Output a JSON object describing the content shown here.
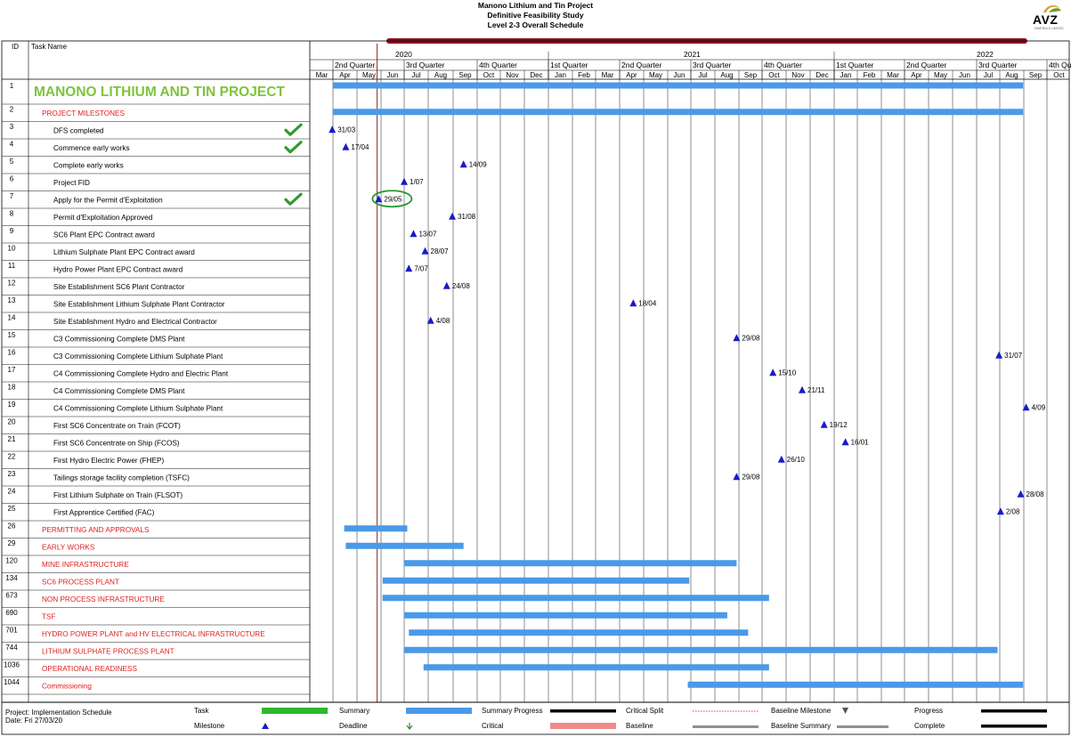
{
  "header": {
    "title_line1": "Manono Lithium and Tin Project",
    "title_line2": "Definitive Feasibility Study",
    "title_line3": "Level 2-3 Overall Schedule",
    "logo_text": "AVZ",
    "logo_subtext": "MINERALS LIMITED"
  },
  "columns": {
    "id": "ID",
    "task_name": "Task Name"
  },
  "timescale": {
    "years": [
      "2020",
      "2021",
      "2022"
    ],
    "quarters": [
      "2nd Quarter",
      "3rd Quarter",
      "4th Quarter",
      "1st Quarter",
      "2nd Quarter",
      "3rd Quarter",
      "4th Quarter",
      "1st Quarter",
      "2nd Quarter",
      "3rd Quarter",
      "4th Qu"
    ],
    "months": [
      "Mar",
      "Apr",
      "May",
      "Jun",
      "Jul",
      "Aug",
      "Sep",
      "Oct",
      "Nov",
      "Dec",
      "Jan",
      "Feb",
      "Mar",
      "Apr",
      "May",
      "Jun",
      "Jul",
      "Aug",
      "Sep",
      "Oct",
      "Nov",
      "Dec",
      "Jan",
      "Feb",
      "Mar",
      "Apr",
      "May",
      "Jun",
      "Jul",
      "Aug",
      "Sep",
      "Oct"
    ]
  },
  "chart_data": {
    "type": "gantt",
    "title": "Level 2-3 Overall Schedule",
    "status_date": "2020-05-27",
    "rows": [
      {
        "id": "1",
        "name": "MANONO LITHIUM AND TIN PROJECT",
        "kind": "project",
        "start": "2020-04-01",
        "end": "2022-08-31"
      },
      {
        "id": "2",
        "name": "PROJECT MILESTONES",
        "kind": "summary",
        "start": "2020-04-01",
        "end": "2022-08-31"
      },
      {
        "id": "3",
        "name": "DFS completed",
        "kind": "milestone",
        "date": "2020-03-31",
        "label": "31/03",
        "complete": true
      },
      {
        "id": "4",
        "name": "Commence early works",
        "kind": "milestone",
        "date": "2020-04-17",
        "label": "17/04",
        "complete": true
      },
      {
        "id": "5",
        "name": "Complete early works",
        "kind": "milestone",
        "date": "2020-09-14",
        "label": "14/09"
      },
      {
        "id": "6",
        "name": "Project FID",
        "kind": "milestone",
        "date": "2020-07-01",
        "label": "1/07"
      },
      {
        "id": "7",
        "name": "Apply for the Permit d'Exploitation",
        "kind": "milestone",
        "date": "2020-05-29",
        "label": "29/05",
        "complete": true,
        "highlighted": true
      },
      {
        "id": "8",
        "name": "Permit d'Exploitation Approved",
        "kind": "milestone",
        "date": "2020-08-31",
        "label": "31/08"
      },
      {
        "id": "9",
        "name": "SC6 Plant EPC Contract award",
        "kind": "milestone",
        "date": "2020-07-13",
        "label": "13/07"
      },
      {
        "id": "10",
        "name": "Lithium Sulphate Plant EPC Contract award",
        "kind": "milestone",
        "date": "2020-07-28",
        "label": "28/07"
      },
      {
        "id": "11",
        "name": "Hydro Power Plant EPC Contract award",
        "kind": "milestone",
        "date": "2020-07-07",
        "label": "7/07"
      },
      {
        "id": "12",
        "name": "Site Establishment SC6 Plant Contractor",
        "kind": "milestone",
        "date": "2020-08-24",
        "label": "24/08"
      },
      {
        "id": "13",
        "name": "Site Establishment Lithium Sulphate Plant Contractor",
        "kind": "milestone",
        "date": "2021-04-18",
        "label": "18/04"
      },
      {
        "id": "14",
        "name": "Site Establishment Hydro and Electrical Contractor",
        "kind": "milestone",
        "date": "2020-08-04",
        "label": "4/08"
      },
      {
        "id": "15",
        "name": "C3 Commissioning Complete DMS Plant",
        "kind": "milestone",
        "date": "2021-08-29",
        "label": "29/08"
      },
      {
        "id": "16",
        "name": "C3 Commissioning Complete Lithium Sulphate Plant",
        "kind": "milestone",
        "date": "2022-07-31",
        "label": "31/07"
      },
      {
        "id": "17",
        "name": "C4 Commissioning Complete Hydro and Electric Plant",
        "kind": "milestone",
        "date": "2021-10-15",
        "label": "15/10"
      },
      {
        "id": "18",
        "name": "C4 Commissioning Complete DMS Plant",
        "kind": "milestone",
        "date": "2021-11-21",
        "label": "21/11"
      },
      {
        "id": "19",
        "name": "C4 Commissioning Complete Lithium Sulphate Plant",
        "kind": "milestone",
        "date": "2022-09-04",
        "label": "4/09"
      },
      {
        "id": "20",
        "name": "First SC6 Concentrate on Train (FCOT)",
        "kind": "milestone",
        "date": "2021-12-19",
        "label": "19/12"
      },
      {
        "id": "21",
        "name": "First SC6 Concentrate on Ship (FCOS)",
        "kind": "milestone",
        "date": "2022-01-16",
        "label": "16/01"
      },
      {
        "id": "22",
        "name": "First Hydro Electric Power (FHEP)",
        "kind": "milestone",
        "date": "2021-10-26",
        "label": "26/10"
      },
      {
        "id": "23",
        "name": "Tailings storage facility completion  (TSFC)",
        "kind": "milestone",
        "date": "2021-08-29",
        "label": "29/08"
      },
      {
        "id": "24",
        "name": "First Lithium Sulphate on Train (FLSOT)",
        "kind": "milestone",
        "date": "2022-08-28",
        "label": "28/08"
      },
      {
        "id": "25",
        "name": "First Apprentice Certified (FAC)",
        "kind": "milestone",
        "date": "2022-08-02",
        "label": "2/08"
      },
      {
        "id": "26",
        "name": "PERMITTING AND APPROVALS",
        "kind": "summary",
        "start": "2020-04-15",
        "end": "2020-07-05"
      },
      {
        "id": "29",
        "name": "EARLY WORKS",
        "kind": "summary",
        "start": "2020-04-17",
        "end": "2020-09-14"
      },
      {
        "id": "120",
        "name": "MINE INFRASTRUCTURE",
        "kind": "summary",
        "start": "2020-07-01",
        "end": "2021-08-29"
      },
      {
        "id": "134",
        "name": "SC6  PROCESS PLANT",
        "kind": "summary",
        "start": "2020-06-03",
        "end": "2021-06-29"
      },
      {
        "id": "673",
        "name": "NON PROCESS INFRASTRUCTURE",
        "kind": "summary",
        "start": "2020-06-03",
        "end": "2021-10-10"
      },
      {
        "id": "690",
        "name": "TSF",
        "kind": "summary",
        "start": "2020-07-01",
        "end": "2021-08-17"
      },
      {
        "id": "701",
        "name": "HYDRO POWER PLANT and HV  ELECTRICAL INFRASTRUCTURE",
        "kind": "summary",
        "start": "2020-07-07",
        "end": "2021-09-13"
      },
      {
        "id": "744",
        "name": "LITHIUM SULPHATE PROCESS PLANT",
        "kind": "summary",
        "start": "2020-07-01",
        "end": "2022-07-29"
      },
      {
        "id": "1036",
        "name": "OPERATIONAL READINESS",
        "kind": "summary",
        "start": "2020-07-26",
        "end": "2021-10-10"
      },
      {
        "id": "1044",
        "name": "Commissioning",
        "kind": "summary",
        "start": "2021-06-27",
        "end": "2022-08-31"
      }
    ]
  },
  "footer": {
    "project_label": "Project: Implementation Schedule",
    "date_label": "Date: Fri 27/03/20",
    "legend": [
      {
        "label": "Task",
        "style": "task",
        "color": "#2db82d"
      },
      {
        "label": "Milestone",
        "style": "milestone",
        "color": "#1a1acc"
      },
      {
        "label": "Summary",
        "style": "summary",
        "color": "#4a9ae8"
      },
      {
        "label": "Deadline",
        "style": "deadline",
        "color": "#2f8f2f"
      },
      {
        "label": "Summary Progress",
        "style": "thick-black",
        "color": "#000000"
      },
      {
        "label": "Critical",
        "style": "critical",
        "color": "#ee8a8a"
      },
      {
        "label": "Critical Split",
        "style": "critical-split",
        "color": "#d04040"
      },
      {
        "label": "Baseline",
        "style": "baseline",
        "color": "#909090"
      },
      {
        "label": "Baseline Milestone",
        "style": "baseline-milestone",
        "color": "#555555"
      },
      {
        "label": "Baseline Summary",
        "style": "baseline-summary",
        "color": "#909090"
      },
      {
        "label": "Progress",
        "style": "thick-black",
        "color": "#000000"
      },
      {
        "label": "Complete",
        "style": "thick-black",
        "color": "#000000"
      }
    ]
  },
  "colors": {
    "summary_bar": "#4a9ae8",
    "milestone": "#1a1acc",
    "project_title": "#7ec43c",
    "section_text": "#e02020",
    "status_line": "#8b0a0a",
    "top_bar": "#8b1020",
    "checkmark": "#2f9a2f",
    "highlight_oval": "#1f9a2f"
  }
}
